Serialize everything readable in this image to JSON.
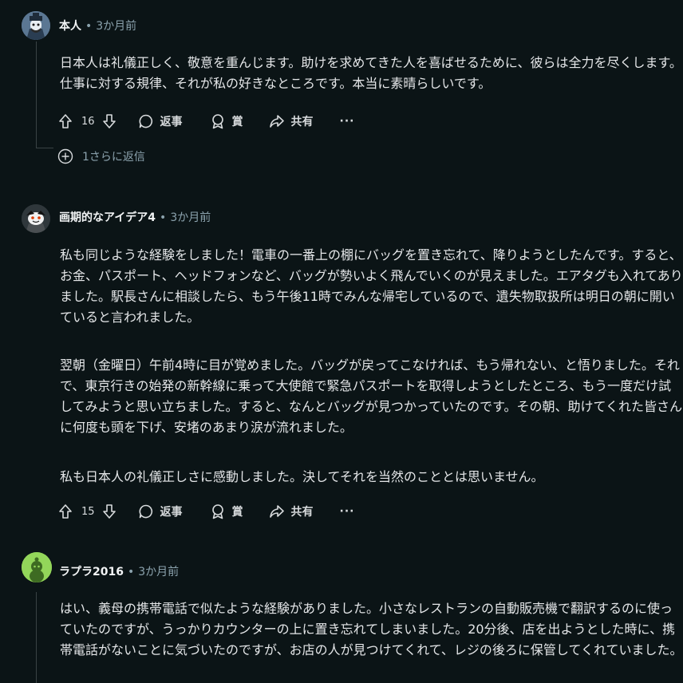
{
  "comments": [
    {
      "author": "本人",
      "time": "3か月前",
      "paragraphs": [
        [
          "日本人は礼儀正しく、敬意を重んじます。助けを求めてきた人を喜ばせるために、彼らは全力を尽くします。",
          "仕事に対する規律、それが私の好きなところです。本当に素晴らしいです。"
        ]
      ],
      "votes": "16",
      "reply_label": "返事",
      "award_label": "賞",
      "share_label": "共有",
      "more_label": "···",
      "more_replies": "1さらに返信"
    },
    {
      "author": "画期的なアイデア4",
      "time": "3か月前",
      "paragraphs": [
        [
          "私も同じような経験をしました！電車の一番上の棚にバッグを置き忘れて、降りようとしたんです。すると、",
          "お金、パスポート、ヘッドフォンなど、バッグが勢いよく飛んでいくのが見えました。エアタグも入れてあり",
          "ました。駅長さんに相談したら、もう午後11時でみんな帰宅しているので、遺失物取扱所は明日の朝に開い",
          "ていると言われました。"
        ],
        [
          "翌朝（金曜日）午前4時に目が覚めました。バッグが戻ってこなければ、もう帰れない、と悟りました。それ",
          "で、東京行きの始発の新幹線に乗って大使館で緊急パスポートを取得しようとしたところ、もう一度だけ試",
          "してみようと思い立ちました。すると、なんとバッグが見つかっていたのです。その朝、助けてくれた皆さん",
          "に何度も頭を下げ、安堵のあまり涙が流れました。"
        ],
        [
          "私も日本人の礼儀正しさに感動しました。決してそれを当然のこととは思いません。"
        ]
      ],
      "votes": "15",
      "reply_label": "返事",
      "award_label": "賞",
      "share_label": "共有",
      "more_label": "···"
    },
    {
      "author": "ラプラ2016",
      "time": "3か月前",
      "paragraphs": [
        [
          "はい、義母の携帯電話で似たような経験がありました。小さなレストランの自動販売機で翻訳するのに使っ",
          "ていたのですが、うっかりカウンターの上に置き忘れてしまいました。20分後、店を出ようとした時に、携",
          "帯電話がないことに気づいたのですが、お店の人が見つけてくれて、レジの後ろに保管してくれていました。"
        ]
      ]
    }
  ],
  "colors": {
    "background": "#0b1416",
    "text": "#d7dadc",
    "muted": "#8ba2ad",
    "thread": "#3a4345"
  },
  "icons": [
    "upvote-icon",
    "downvote-icon",
    "comment-icon",
    "award-icon",
    "share-icon",
    "plus-circle-icon"
  ]
}
